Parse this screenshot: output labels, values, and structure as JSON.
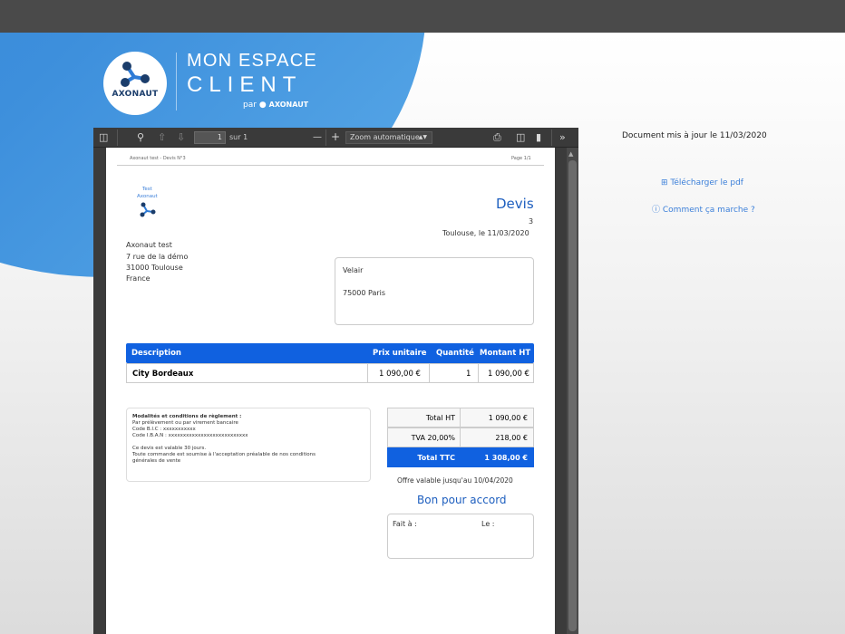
{
  "brand": {
    "logo_text": "AXONAUT",
    "title_line1": "MON ESPACE",
    "title_line2": "CLIENT",
    "par_label": "par",
    "par_brand": "AXONAUT"
  },
  "viewer": {
    "page_current": "1",
    "page_of": "sur 1",
    "zoom_label": "Zoom automatique",
    "zoom_minus": "—",
    "zoom_plus": "+"
  },
  "document": {
    "header_left": "Axonaut test - Devis N°3",
    "header_right": "Page 1/1",
    "logo_line1": "Test",
    "logo_line2": "Axonaut",
    "title": "Devis",
    "number": "3",
    "place_date": "Toulouse, le 11/03/2020",
    "sender": {
      "name": "Axonaut test",
      "street": "7 rue de la démo",
      "city": "31000 Toulouse",
      "country": "France"
    },
    "recipient": {
      "name": "Velair",
      "city": "75000 Paris"
    },
    "table": {
      "headers": [
        "Description",
        "Prix unitaire",
        "Quantité",
        "Montant HT"
      ],
      "rows": [
        [
          "City Bordeaux",
          "1 090,00 €",
          "1",
          "1 090,00 €"
        ]
      ]
    },
    "conditions": {
      "title": "Modalités et conditions de règlement :",
      "line1": "Par prélèvement ou par virement bancaire",
      "bic": "Code B.I.C : xxxxxxxxxxx",
      "iban": "Code I.B.A.N : xxxxxxxxxxxxxxxxxxxxxxxxxxx",
      "validity": "Ce devis est valable 30 jours.",
      "cgv1": "Toute commande est soumise à l'acceptation préalable de nos conditions",
      "cgv2": "générales de vente"
    },
    "totals": {
      "ht_label": "Total HT",
      "ht_value": "1 090,00 €",
      "tva_label": "TVA 20,00%",
      "tva_value": "218,00 €",
      "ttc_label": "Total TTC",
      "ttc_value": "1 308,00 €"
    },
    "offer_valid": "Offre valable jusqu'au 10/04/2020",
    "accord_title": "Bon pour accord",
    "fait_a": "Fait à :",
    "le": "Le :"
  },
  "side": {
    "updated": "Document mis à jour le 11/03/2020",
    "download": "Télécharger le pdf",
    "how": "Comment ça marche ?"
  },
  "colors": {
    "brand_blue": "#3d8fdc",
    "table_blue": "#1061e0",
    "link_blue": "#3b7fd9"
  }
}
